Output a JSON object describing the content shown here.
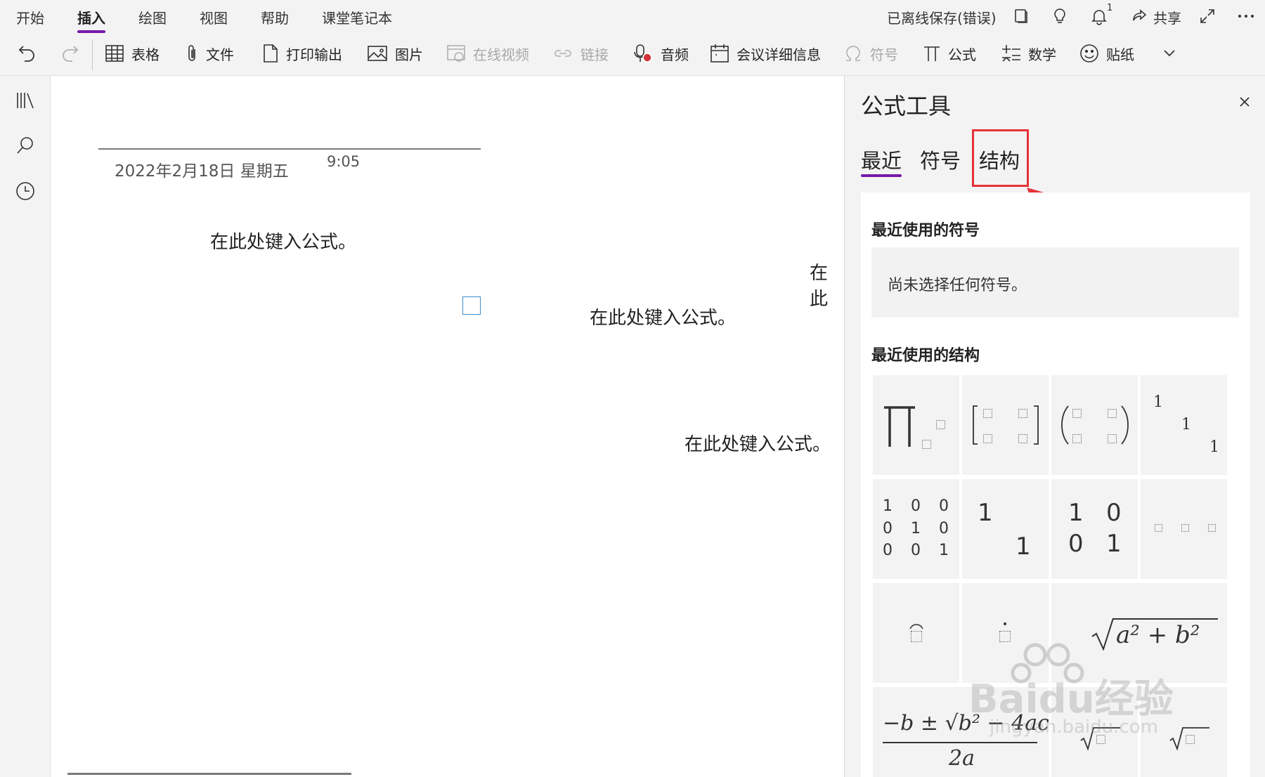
{
  "menu": {
    "tabs": [
      {
        "label": "开始"
      },
      {
        "label": "插入",
        "active": true
      },
      {
        "label": "绘图"
      },
      {
        "label": "视图"
      },
      {
        "label": "帮助"
      },
      {
        "label": "课堂笔记本"
      }
    ],
    "status": "已离线保存(错误)",
    "notification_count": "1",
    "share_label": "共享"
  },
  "ribbon": {
    "table": "表格",
    "file": "文件",
    "printout": "打印输出",
    "picture": "图片",
    "online_video": "在线视频",
    "link": "链接",
    "audio": "音频",
    "meeting_details": "会议详细信息",
    "symbol": "符号",
    "equation": "公式",
    "math": "数学",
    "sticker": "贴纸"
  },
  "note": {
    "date": "2022年2月18日 星期五",
    "time": "9:05",
    "eq1": "在此处键入公式。",
    "eq2": "在此处键入公式。",
    "eq3": "在此处键入公式。",
    "eq_clipped": "在此"
  },
  "pane": {
    "title": "公式工具",
    "tabs": {
      "recent": "最近",
      "symbols": "符号",
      "structures": "结构"
    },
    "recent_symbols_label": "最近使用的符号",
    "no_symbols_text": "尚未选择任何符号。",
    "recent_structures_label": "最近使用的结构",
    "tiles": {
      "one": "1",
      "zero": "0",
      "sqrt_expr": "a² + b²",
      "quad_num": "−b ± √b² − 4ac",
      "quad_den": "2a"
    }
  },
  "watermark": {
    "brand": "Baidu经验",
    "url": "jingyan.baidu.com"
  },
  "colors": {
    "accent": "#7719aa",
    "highlight": "#e53238",
    "selection": "#3b8ed0"
  }
}
